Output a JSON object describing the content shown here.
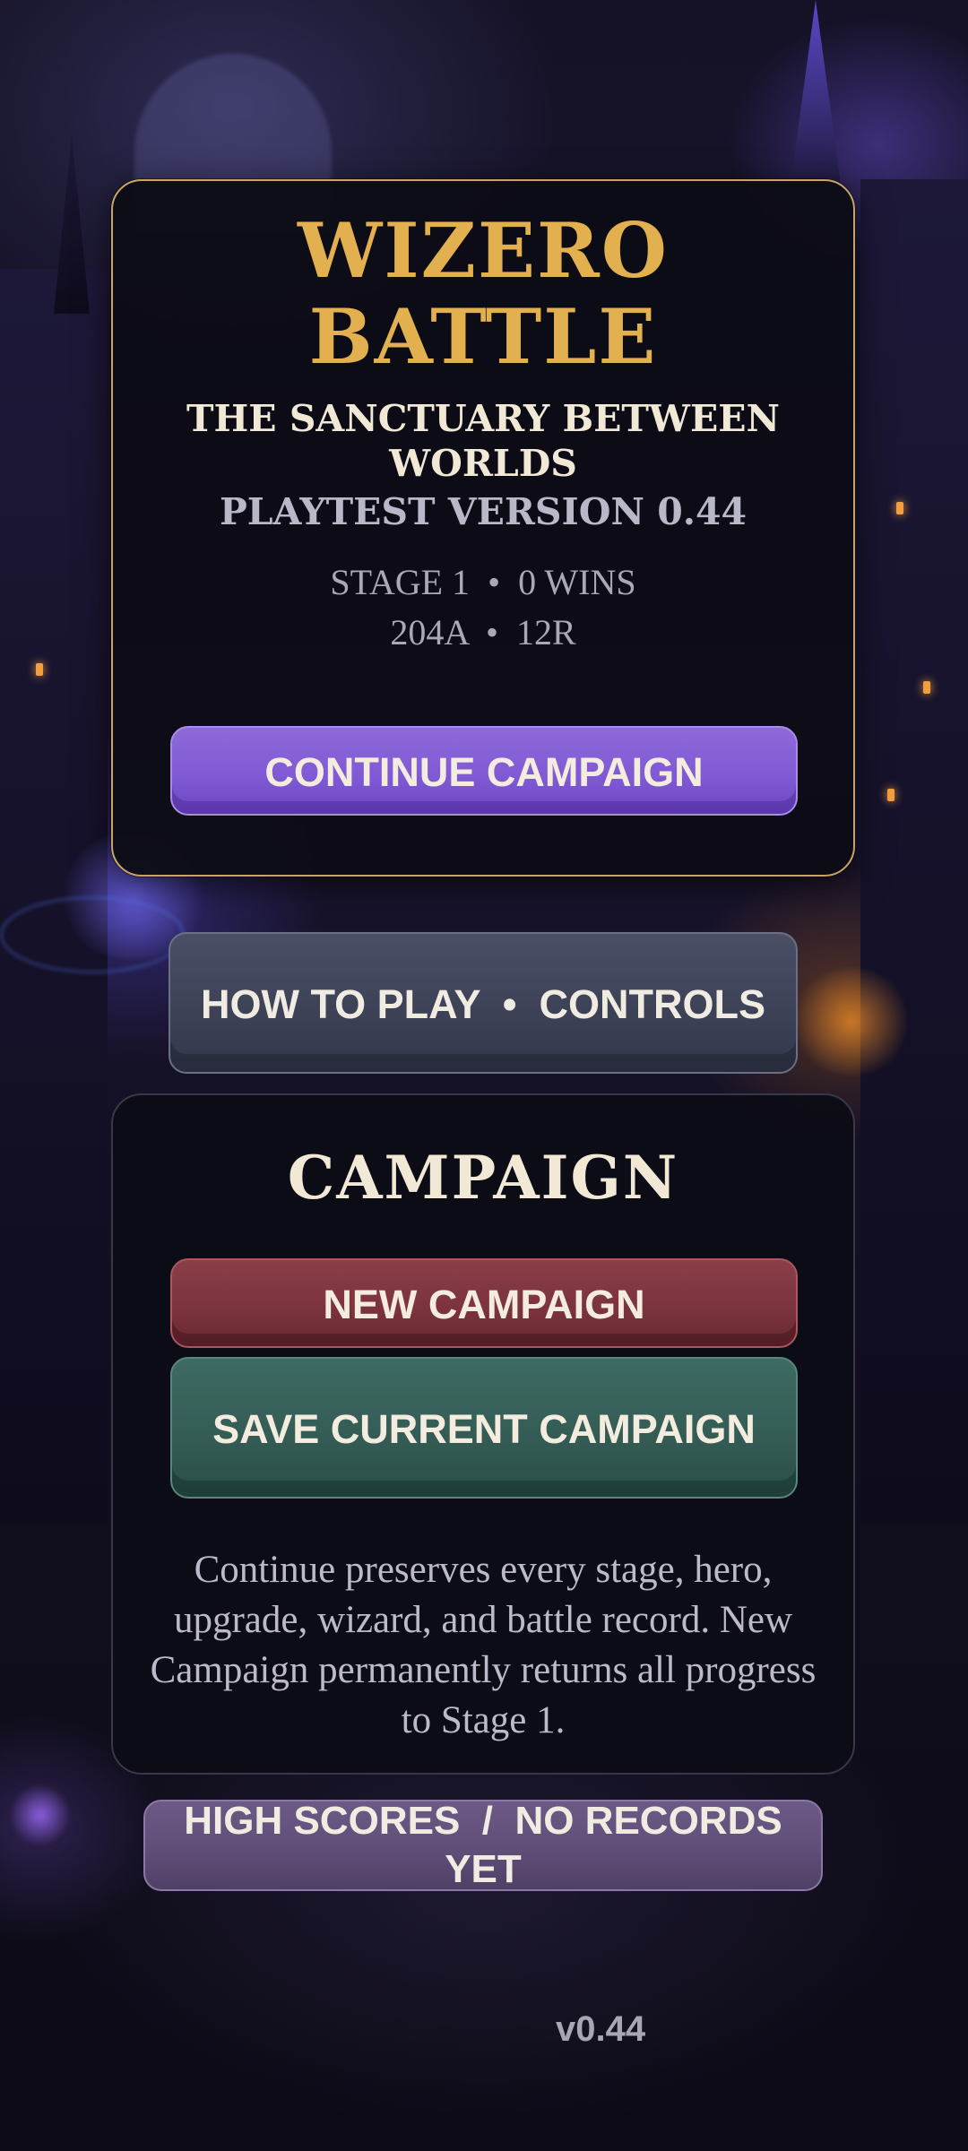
{
  "title_panel": {
    "title_line1": "WIZERO",
    "title_line2": "BATTLE",
    "subtitle": "THE SANCTUARY BETWEEN WORLDS",
    "version_line": "PLAYTEST VERSION 0.44",
    "stats_line1": "STAGE 1  •  0 WINS",
    "stats_line2": "204A  •  12R",
    "continue_label": "CONTINUE CAMPAIGN"
  },
  "how_to_play_label": "HOW TO PLAY  •  CONTROLS",
  "campaign_panel": {
    "heading": "CAMPAIGN",
    "new_label": "NEW CAMPAIGN",
    "save_label": "SAVE CURRENT CAMPAIGN",
    "help_text": "Continue preserves every stage, hero, upgrade, wizard, and battle record. New Campaign permanently returns all progress to Stage 1."
  },
  "high_scores_label": "HIGH SCORES  /  NO RECORDS YET",
  "version_tag": "v0.44",
  "colors": {
    "accent_gold": "#e3b04f",
    "continue_purple": "#7f58d4",
    "new_red": "#7a323c",
    "save_teal": "#335b54",
    "scores_purple": "#5f4e78"
  }
}
